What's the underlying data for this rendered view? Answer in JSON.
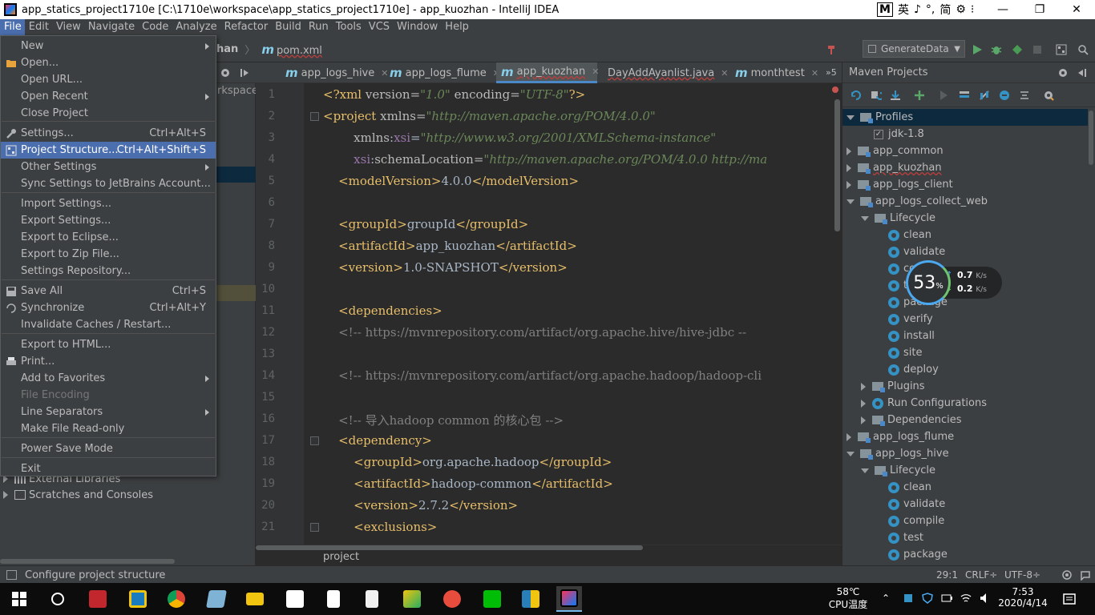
{
  "window": {
    "title": "app_statics_project1710e [C:\\1710e\\workspace\\app_statics_project1710e] - app_kuozhan - IntelliJ IDEA",
    "ime": {
      "box": "M",
      "items": [
        "英",
        "♪",
        "°,",
        "简",
        "⚙",
        "⁝"
      ]
    },
    "controls": {
      "minimize": "—",
      "maximize": "❐",
      "close": "✕"
    }
  },
  "menubar": {
    "items": [
      {
        "label": "File",
        "active": true
      },
      {
        "label": "Edit"
      },
      {
        "label": "View"
      },
      {
        "label": "Navigate"
      },
      {
        "label": "Code"
      },
      {
        "label": "Analyze"
      },
      {
        "label": "Refactor"
      },
      {
        "label": "Build"
      },
      {
        "label": "Run"
      },
      {
        "label": "Tools"
      },
      {
        "label": "VCS"
      },
      {
        "label": "Window"
      },
      {
        "label": "Help"
      }
    ]
  },
  "breadcrumb": {
    "fragment": "han",
    "file": "pom.xml"
  },
  "run_config": {
    "name": "GenerateData"
  },
  "file_menu": {
    "items": [
      {
        "label": "New",
        "submenu": true
      },
      {
        "label": "Open...",
        "icon": "folder-icon"
      },
      {
        "label": "Open URL..."
      },
      {
        "label": "Open Recent",
        "submenu": true
      },
      {
        "label": "Close Project"
      },
      {
        "label": "Settings...",
        "shortcut": "Ctrl+Alt+S",
        "icon": "wrench-icon"
      },
      {
        "label": "Project Structure...",
        "shortcut": "Ctrl+Alt+Shift+S",
        "icon": "project-structure-icon",
        "selected": true
      },
      {
        "label": "Other Settings",
        "submenu": true
      },
      {
        "label": "Sync Settings to JetBrains Account..."
      },
      {
        "label": "Import Settings..."
      },
      {
        "label": "Export Settings..."
      },
      {
        "label": "Export to Eclipse..."
      },
      {
        "label": "Export to Zip File..."
      },
      {
        "label": "Settings Repository..."
      },
      {
        "label": "Save All",
        "shortcut": "Ctrl+S",
        "icon": "save-icon"
      },
      {
        "label": "Synchronize",
        "shortcut": "Ctrl+Alt+Y",
        "icon": "sync-icon"
      },
      {
        "label": "Invalidate Caches / Restart..."
      },
      {
        "label": "Export to HTML..."
      },
      {
        "label": "Print...",
        "icon": "print-icon"
      },
      {
        "label": "Add to Favorites",
        "submenu": true
      },
      {
        "label": "File Encoding",
        "disabled": true
      },
      {
        "label": "Line Separators",
        "submenu": true
      },
      {
        "label": "Make File Read-only"
      },
      {
        "label": "Power Save Mode"
      },
      {
        "label": "Exit"
      }
    ]
  },
  "project_tree": {
    "fragments": [
      "rkspace\\"
    ],
    "items": [
      {
        "label": "External Libraries"
      },
      {
        "label": "Scratches and Consoles"
      }
    ]
  },
  "tabs": [
    {
      "label": "app_logs_hive",
      "kind": "m"
    },
    {
      "label": "app_logs_flume",
      "kind": "m"
    },
    {
      "label": "app_kuozhan",
      "kind": "m",
      "active": true
    },
    {
      "label": "DayAddAyanlist.java",
      "kind": "c"
    },
    {
      "label": "monthtest",
      "kind": "m"
    }
  ],
  "tab_overflow": "»5",
  "editor": {
    "lines": [
      "1",
      "2",
      "3",
      "4",
      "5",
      "6",
      "7",
      "8",
      "9",
      "10",
      "11",
      "12",
      "13",
      "14",
      "15",
      "16",
      "17",
      "18",
      "19",
      "20",
      "21"
    ],
    "breadcrumb": "project"
  },
  "maven": {
    "title": "Maven Projects",
    "tree": [
      {
        "label": "Profiles",
        "level": 0,
        "type": "folder",
        "expanded": true,
        "selected": true
      },
      {
        "label": "jdk-1.8",
        "level": 1,
        "type": "check"
      },
      {
        "label": "app_common",
        "level": 0,
        "type": "module",
        "expanded": false
      },
      {
        "label": "app_kuozhan",
        "level": 0,
        "type": "module",
        "expanded": false
      },
      {
        "label": "app_logs_client",
        "level": 0,
        "type": "module",
        "expanded": false
      },
      {
        "label": "app_logs_collect_web",
        "level": 0,
        "type": "module",
        "expanded": true
      },
      {
        "label": "Lifecycle",
        "level": 1,
        "type": "folder",
        "expanded": true
      },
      {
        "label": "clean",
        "level": 2,
        "type": "goal"
      },
      {
        "label": "validate",
        "level": 2,
        "type": "goal"
      },
      {
        "label": "compile",
        "level": 2,
        "type": "goal"
      },
      {
        "label": "test",
        "level": 2,
        "type": "goal"
      },
      {
        "label": "package",
        "level": 2,
        "type": "goal"
      },
      {
        "label": "verify",
        "level": 2,
        "type": "goal"
      },
      {
        "label": "install",
        "level": 2,
        "type": "goal"
      },
      {
        "label": "site",
        "level": 2,
        "type": "goal"
      },
      {
        "label": "deploy",
        "level": 2,
        "type": "goal"
      },
      {
        "label": "Plugins",
        "level": 1,
        "type": "folder",
        "expanded": false
      },
      {
        "label": "Run Configurations",
        "level": 1,
        "type": "gear",
        "expanded": false
      },
      {
        "label": "Dependencies",
        "level": 1,
        "type": "folder",
        "expanded": false
      },
      {
        "label": "app_logs_flume",
        "level": 0,
        "type": "module",
        "expanded": false
      },
      {
        "label": "app_logs_hive",
        "level": 0,
        "type": "module",
        "expanded": true
      },
      {
        "label": "Lifecycle",
        "level": 1,
        "type": "folder",
        "expanded": true
      },
      {
        "label": "clean",
        "level": 2,
        "type": "goal"
      },
      {
        "label": "validate",
        "level": 2,
        "type": "goal"
      },
      {
        "label": "compile",
        "level": 2,
        "type": "goal"
      },
      {
        "label": "test",
        "level": 2,
        "type": "goal"
      },
      {
        "label": "package",
        "level": 2,
        "type": "goal"
      }
    ]
  },
  "net_widget": {
    "percent": "53",
    "percent_sign": "%",
    "up": "0.7",
    "down": "0.2",
    "unit": "K/s"
  },
  "statusbar": {
    "message": "Configure project structure",
    "position": "29:1",
    "line_sep": "CRLF÷",
    "encoding": "UTF-8÷"
  },
  "taskbar": {
    "weather_temp": "58℃",
    "weather_label": "CPU温度",
    "time": "7:53",
    "date": "2020/4/14"
  }
}
